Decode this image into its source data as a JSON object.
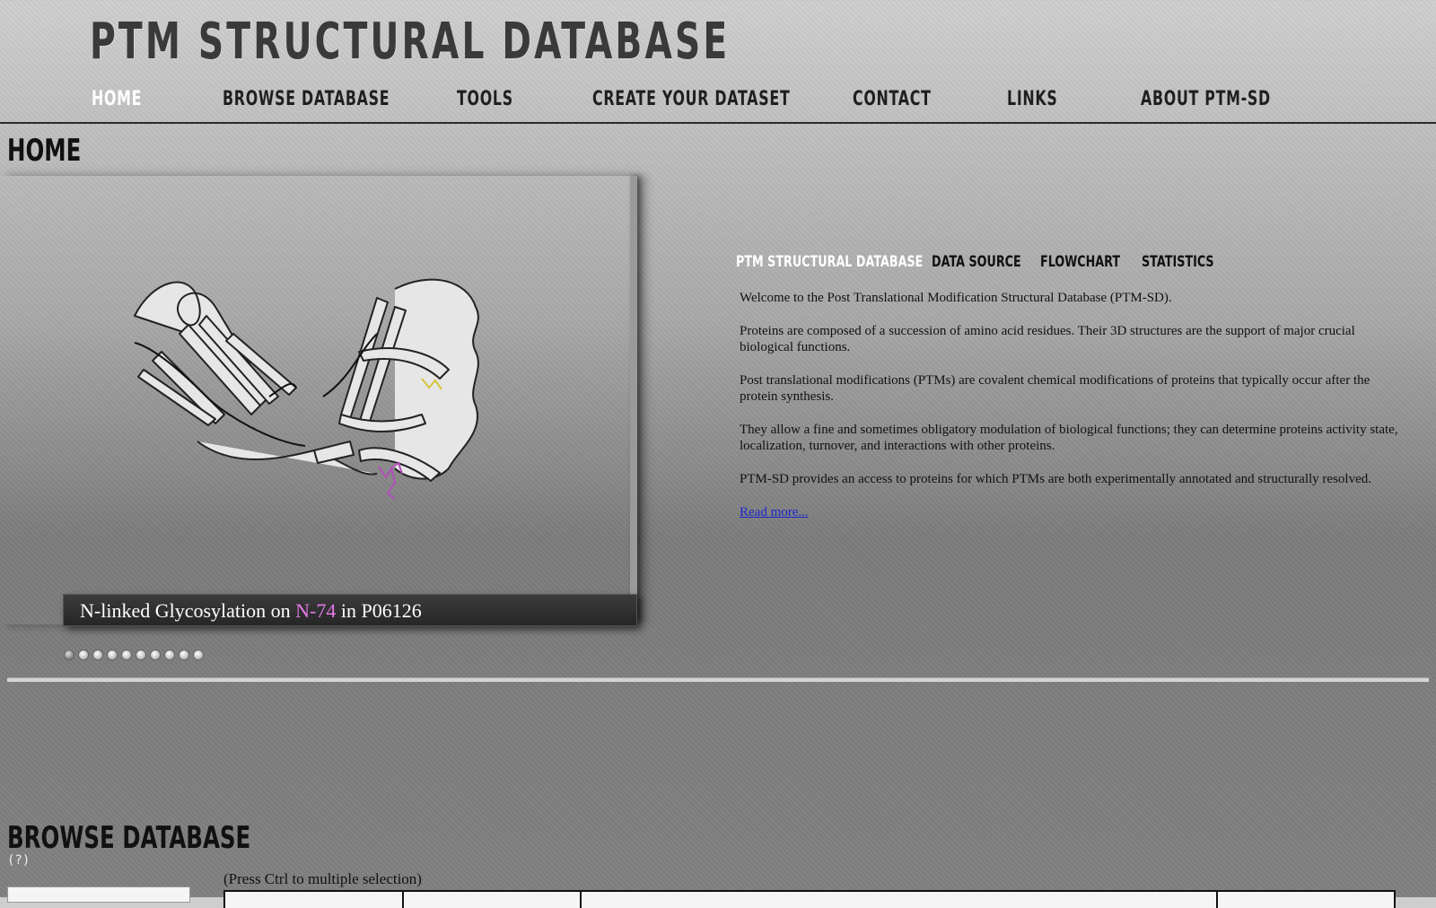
{
  "site": {
    "title": "PTM STRUCTURAL DATABASE"
  },
  "nav": {
    "items": [
      {
        "label": "HOME"
      },
      {
        "label": "BROWSE DATABASE"
      },
      {
        "label": "TOOLS"
      },
      {
        "label": "CREATE YOUR DATASET"
      },
      {
        "label": "CONTACT"
      },
      {
        "label": "LINKS"
      },
      {
        "label": "ABOUT PTM-SD"
      }
    ],
    "active": "HOME"
  },
  "home": {
    "heading": "HOME",
    "slideshow": {
      "caption_before": "N-linked Glycosylation on ",
      "caption_site": "N-74",
      "caption_after": " in P06126",
      "slide_count": 10,
      "active_slide": 1
    }
  },
  "info": {
    "tabs": [
      {
        "label": "PTM STRUCTURAL DATABASE"
      },
      {
        "label": "DATA SOURCE"
      },
      {
        "label": "FLOWCHART"
      },
      {
        "label": "STATISTICS"
      }
    ],
    "active_tab": "PTM STRUCTURAL DATABASE",
    "paragraphs": [
      "Welcome to the Post Translational Modification Structural Database (PTM-SD).",
      "Proteins are composed of a succession of amino acid residues. Their 3D structures are the support of major crucial biological functions.",
      "Post translational modifications (PTMs) are covalent chemical modifications of proteins that typically occur after the protein synthesis.",
      "They allow a fine and sometimes obligatory modulation of biological functions; they can determine proteins activity state, localization, turnover, and interactions with other proteins.",
      "PTM-SD provides an access to proteins for which PTMs are both experimentally annotated and structurally resolved."
    ],
    "read_more": "Read more..."
  },
  "browse": {
    "heading": "BROWSE DATABASE",
    "help": "(?)",
    "hint": "(Press Ctrl to multiple selection)"
  },
  "colors": {
    "active_nav": "#ffffff",
    "highlight_site": "#e57ae8",
    "link": "#1a27c9"
  }
}
